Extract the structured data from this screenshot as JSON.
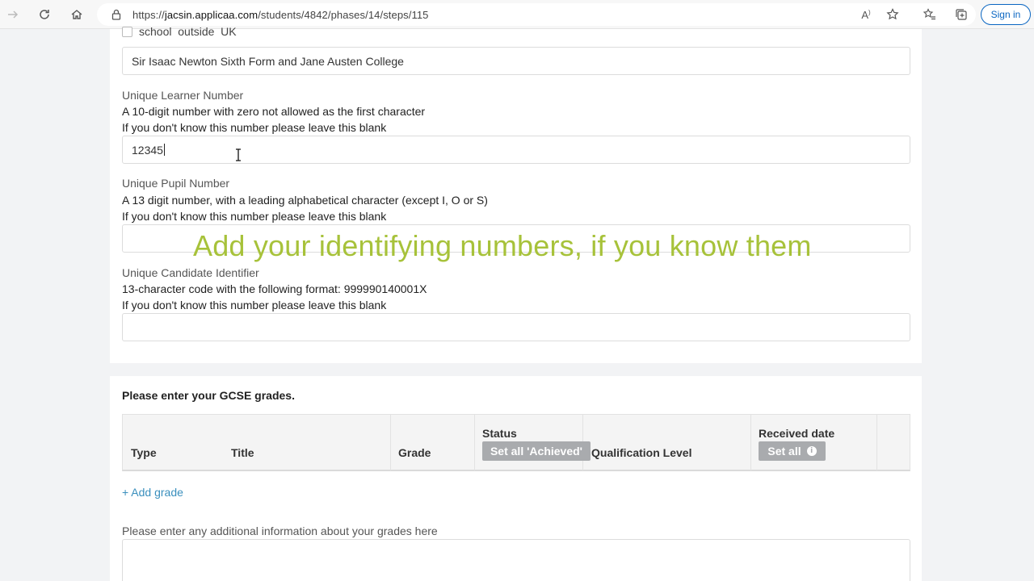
{
  "browser": {
    "url_prefix": "https://",
    "url_host": "jacsin.applicaa.com",
    "url_path": "/students/4842/phases/14/steps/115",
    "read_aloud_glyph": "A",
    "signin_label": "Sign in"
  },
  "form": {
    "school_outside_uk_label": "school_outside_UK",
    "school_value": "Sir Isaac Newton Sixth Form and Jane Austen College",
    "uln": {
      "label": "Unique Learner Number",
      "help1": "A 10-digit number with zero not allowed as the first character",
      "help2": "If you don't know this number please leave this blank",
      "value": "12345"
    },
    "upn": {
      "label": "Unique Pupil Number",
      "help1": "A 13 digit number, with a leading alphabetical character (except I, O or S)",
      "help2": "If you don't know this number please leave this blank",
      "value": ""
    },
    "uci": {
      "label": "Unique Candidate Identifier",
      "help1": "13-character code with the following format: 999990140001X",
      "help2": "If you don't know this number please leave this blank",
      "value": ""
    }
  },
  "overlay_caption": "Add your identifying numbers, if you know them",
  "grades": {
    "title": "Please enter your GCSE grades.",
    "columns": {
      "type": "Type",
      "title": "Title",
      "grade": "Grade",
      "status": "Status",
      "set_all_achieved": "Set all 'Achieved'",
      "qualification_level": "Qualification Level",
      "received_date": "Received date",
      "set_all": "Set all"
    },
    "add_grade": "+ Add grade",
    "additional_info_label": "Please enter any additional information about your grades here"
  },
  "colors": {
    "overlay_text": "#a7c23a",
    "link": "#3a8fbd",
    "button_gray": "#a9abae"
  }
}
